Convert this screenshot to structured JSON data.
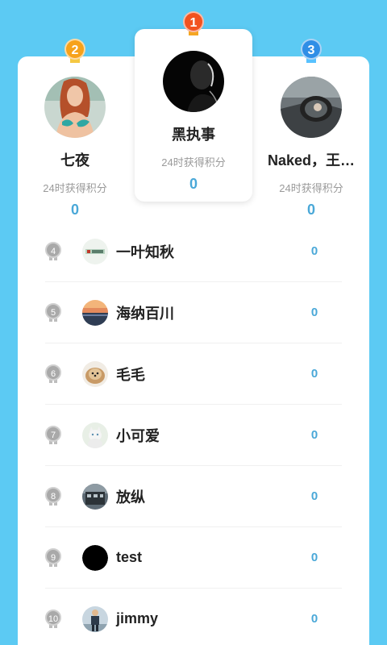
{
  "accent_color": "#4aa8d8",
  "background_color": "#5ccaf3",
  "podium": [
    {
      "rank": "1",
      "name": "黑执事",
      "subtitle": "24时获得积分",
      "score": "0",
      "avatar": "dark-silhouette-avatar"
    },
    {
      "rank": "2",
      "name": "七夜",
      "subtitle": "24时获得积分",
      "score": "0",
      "avatar": "woman-photo-avatar"
    },
    {
      "rank": "3",
      "name": "Naked，王…",
      "subtitle": "24时获得积分",
      "score": "0",
      "avatar": "car-mirror-avatar"
    }
  ],
  "list": [
    {
      "rank": "4",
      "name": "一叶知秋",
      "score": "0",
      "avatar": "text-logo-avatar"
    },
    {
      "rank": "5",
      "name": "海纳百川",
      "score": "0",
      "avatar": "sunset-avatar"
    },
    {
      "rank": "6",
      "name": "毛毛",
      "score": "0",
      "avatar": "dog-avatar"
    },
    {
      "rank": "7",
      "name": "小可爱",
      "score": "0",
      "avatar": "cat-avatar"
    },
    {
      "rank": "8",
      "name": "放纵",
      "score": "0",
      "avatar": "building-avatar"
    },
    {
      "rank": "9",
      "name": "test",
      "score": "0",
      "avatar": "black-avatar"
    },
    {
      "rank": "10",
      "name": "jimmy",
      "score": "0",
      "avatar": "person-avatar"
    }
  ]
}
